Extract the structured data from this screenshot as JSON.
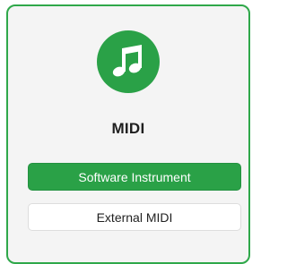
{
  "card": {
    "icon": "music-note-icon",
    "title": "MIDI",
    "accent_color": "#2aa147"
  },
  "buttons": {
    "software_instrument_label": "Software Instrument",
    "external_midi_label": "External MIDI"
  }
}
